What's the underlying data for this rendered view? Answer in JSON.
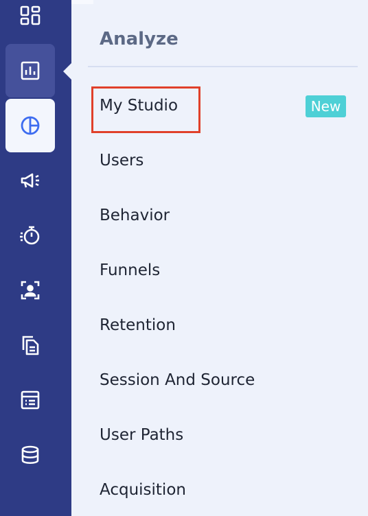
{
  "sidebar": {
    "icons": [
      {
        "name": "dashboard-icon",
        "state": "normal"
      },
      {
        "name": "bar-chart-icon",
        "state": "hover"
      },
      {
        "name": "pie-chart-icon",
        "state": "active"
      },
      {
        "name": "megaphone-icon",
        "state": "normal"
      },
      {
        "name": "stopwatch-icon",
        "state": "normal"
      },
      {
        "name": "user-profile-icon",
        "state": "normal"
      },
      {
        "name": "documents-icon",
        "state": "normal"
      },
      {
        "name": "table-list-icon",
        "state": "normal"
      },
      {
        "name": "database-icon",
        "state": "normal"
      }
    ]
  },
  "panel": {
    "title": "Analyze",
    "items": [
      {
        "label": "My Studio",
        "badge": "New"
      },
      {
        "label": "Users"
      },
      {
        "label": "Behavior"
      },
      {
        "label": "Funnels"
      },
      {
        "label": "Retention"
      },
      {
        "label": "Session And Source"
      },
      {
        "label": "User Paths"
      },
      {
        "label": "Acquisition"
      }
    ]
  },
  "colors": {
    "sidebar": "#2e3b85",
    "panel_bg": "#eef2fb",
    "active_icon": "#3d6cf0",
    "highlight": "#e0402a",
    "badge": "#4ed0d6"
  }
}
